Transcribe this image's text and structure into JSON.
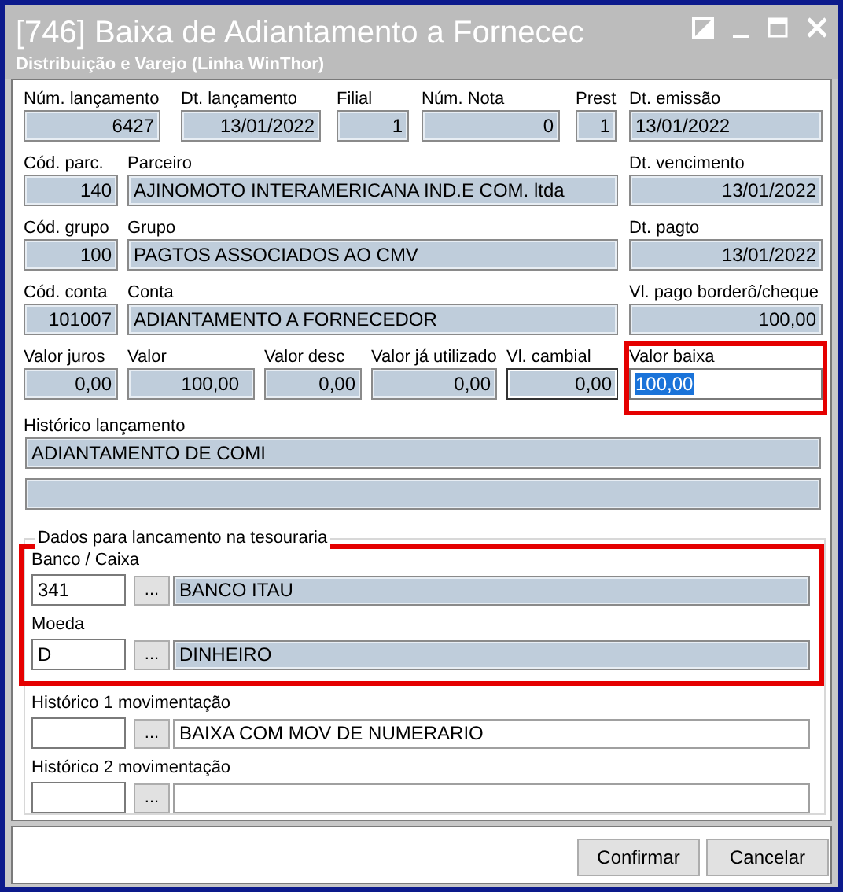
{
  "window": {
    "title": "[746] Baixa de Adiantamento a Fornecec",
    "subtitle": "Distribuição e Varejo (Linha WinThor)"
  },
  "rows": [
    {
      "fields": [
        {
          "label": "Núm. lançamento",
          "value": "6427",
          "kind": "readonly"
        },
        {
          "label": "Dt. lançamento",
          "value": "13/01/2022",
          "kind": "readonly"
        },
        {
          "label": "Filial",
          "value": "1",
          "kind": "readonly"
        },
        {
          "label": "Núm. Nota",
          "value": "0",
          "kind": "readonly"
        },
        {
          "label": "Prest",
          "value": "1",
          "kind": "readonly"
        },
        {
          "label": "Dt. emissão",
          "value": "13/01/2022",
          "kind": "readonly"
        }
      ]
    },
    {
      "fields": [
        {
          "label": "Cód. parc.",
          "value": "140",
          "kind": "readonly"
        },
        {
          "label": "Parceiro",
          "value": "AJINOMOTO INTERAMERICANA IND.E COM. ltda",
          "kind": "readonly"
        },
        {
          "label": "Dt. vencimento",
          "value": "13/01/2022",
          "kind": "readonly"
        }
      ]
    },
    {
      "fields": [
        {
          "label": "Cód. grupo",
          "value": "100",
          "kind": "readonly"
        },
        {
          "label": "Grupo",
          "value": "PAGTOS ASSOCIADOS AO CMV",
          "kind": "readonly"
        },
        {
          "label": "Dt. pagto",
          "value": "13/01/2022",
          "kind": "readonly"
        }
      ]
    },
    {
      "fields": [
        {
          "label": "Cód. conta",
          "value": "101007",
          "kind": "readonly"
        },
        {
          "label": "Conta",
          "value": "ADIANTAMENTO A FORNECEDOR",
          "kind": "readonly"
        },
        {
          "label": "Vl. pago borderô/cheque",
          "value": "100,00",
          "kind": "readonly"
        }
      ]
    },
    {
      "fields": [
        {
          "label": "Valor juros",
          "value": "0,00",
          "kind": "readonly"
        },
        {
          "label": "Valor",
          "value": "100,00",
          "kind": "readonly"
        },
        {
          "label": "Valor desc",
          "value": "0,00",
          "kind": "readonly"
        },
        {
          "label": "Valor já utilizado",
          "value": "0,00",
          "kind": "readonly"
        },
        {
          "label": "Vl. cambial",
          "value": "0,00",
          "kind": "readonly-framed"
        },
        {
          "label": "Valor baixa",
          "value": "100,00",
          "kind": "input",
          "text_selected": true,
          "highlighted": true
        }
      ]
    }
  ],
  "historico": {
    "label": "Histórico lançamento",
    "value": "ADIANTAMENTO DE COMI"
  },
  "treasury": {
    "title": "Dados para lancamento na tesouraria",
    "rows": [
      {
        "label": "Banco / Caixa",
        "code": "341",
        "button": "...",
        "description": "BANCO ITAU",
        "readonly": true,
        "highlighted": true
      },
      {
        "label": "Moeda",
        "code": "D",
        "button": "...",
        "description": "DINHEIRO",
        "readonly": true,
        "highlighted": true
      },
      {
        "label": "Histórico 1 movimentação",
        "button": "...",
        "description": "BAIXA COM MOV DE NUMERARIO",
        "readonly": false,
        "highlighted": false
      },
      {
        "label": "Histórico 2 movimentação",
        "button": "...",
        "readonly": false,
        "highlighted": false
      }
    ]
  },
  "buttons": [
    {
      "label": "Confirmar"
    },
    {
      "label": "Cancelar"
    }
  ]
}
